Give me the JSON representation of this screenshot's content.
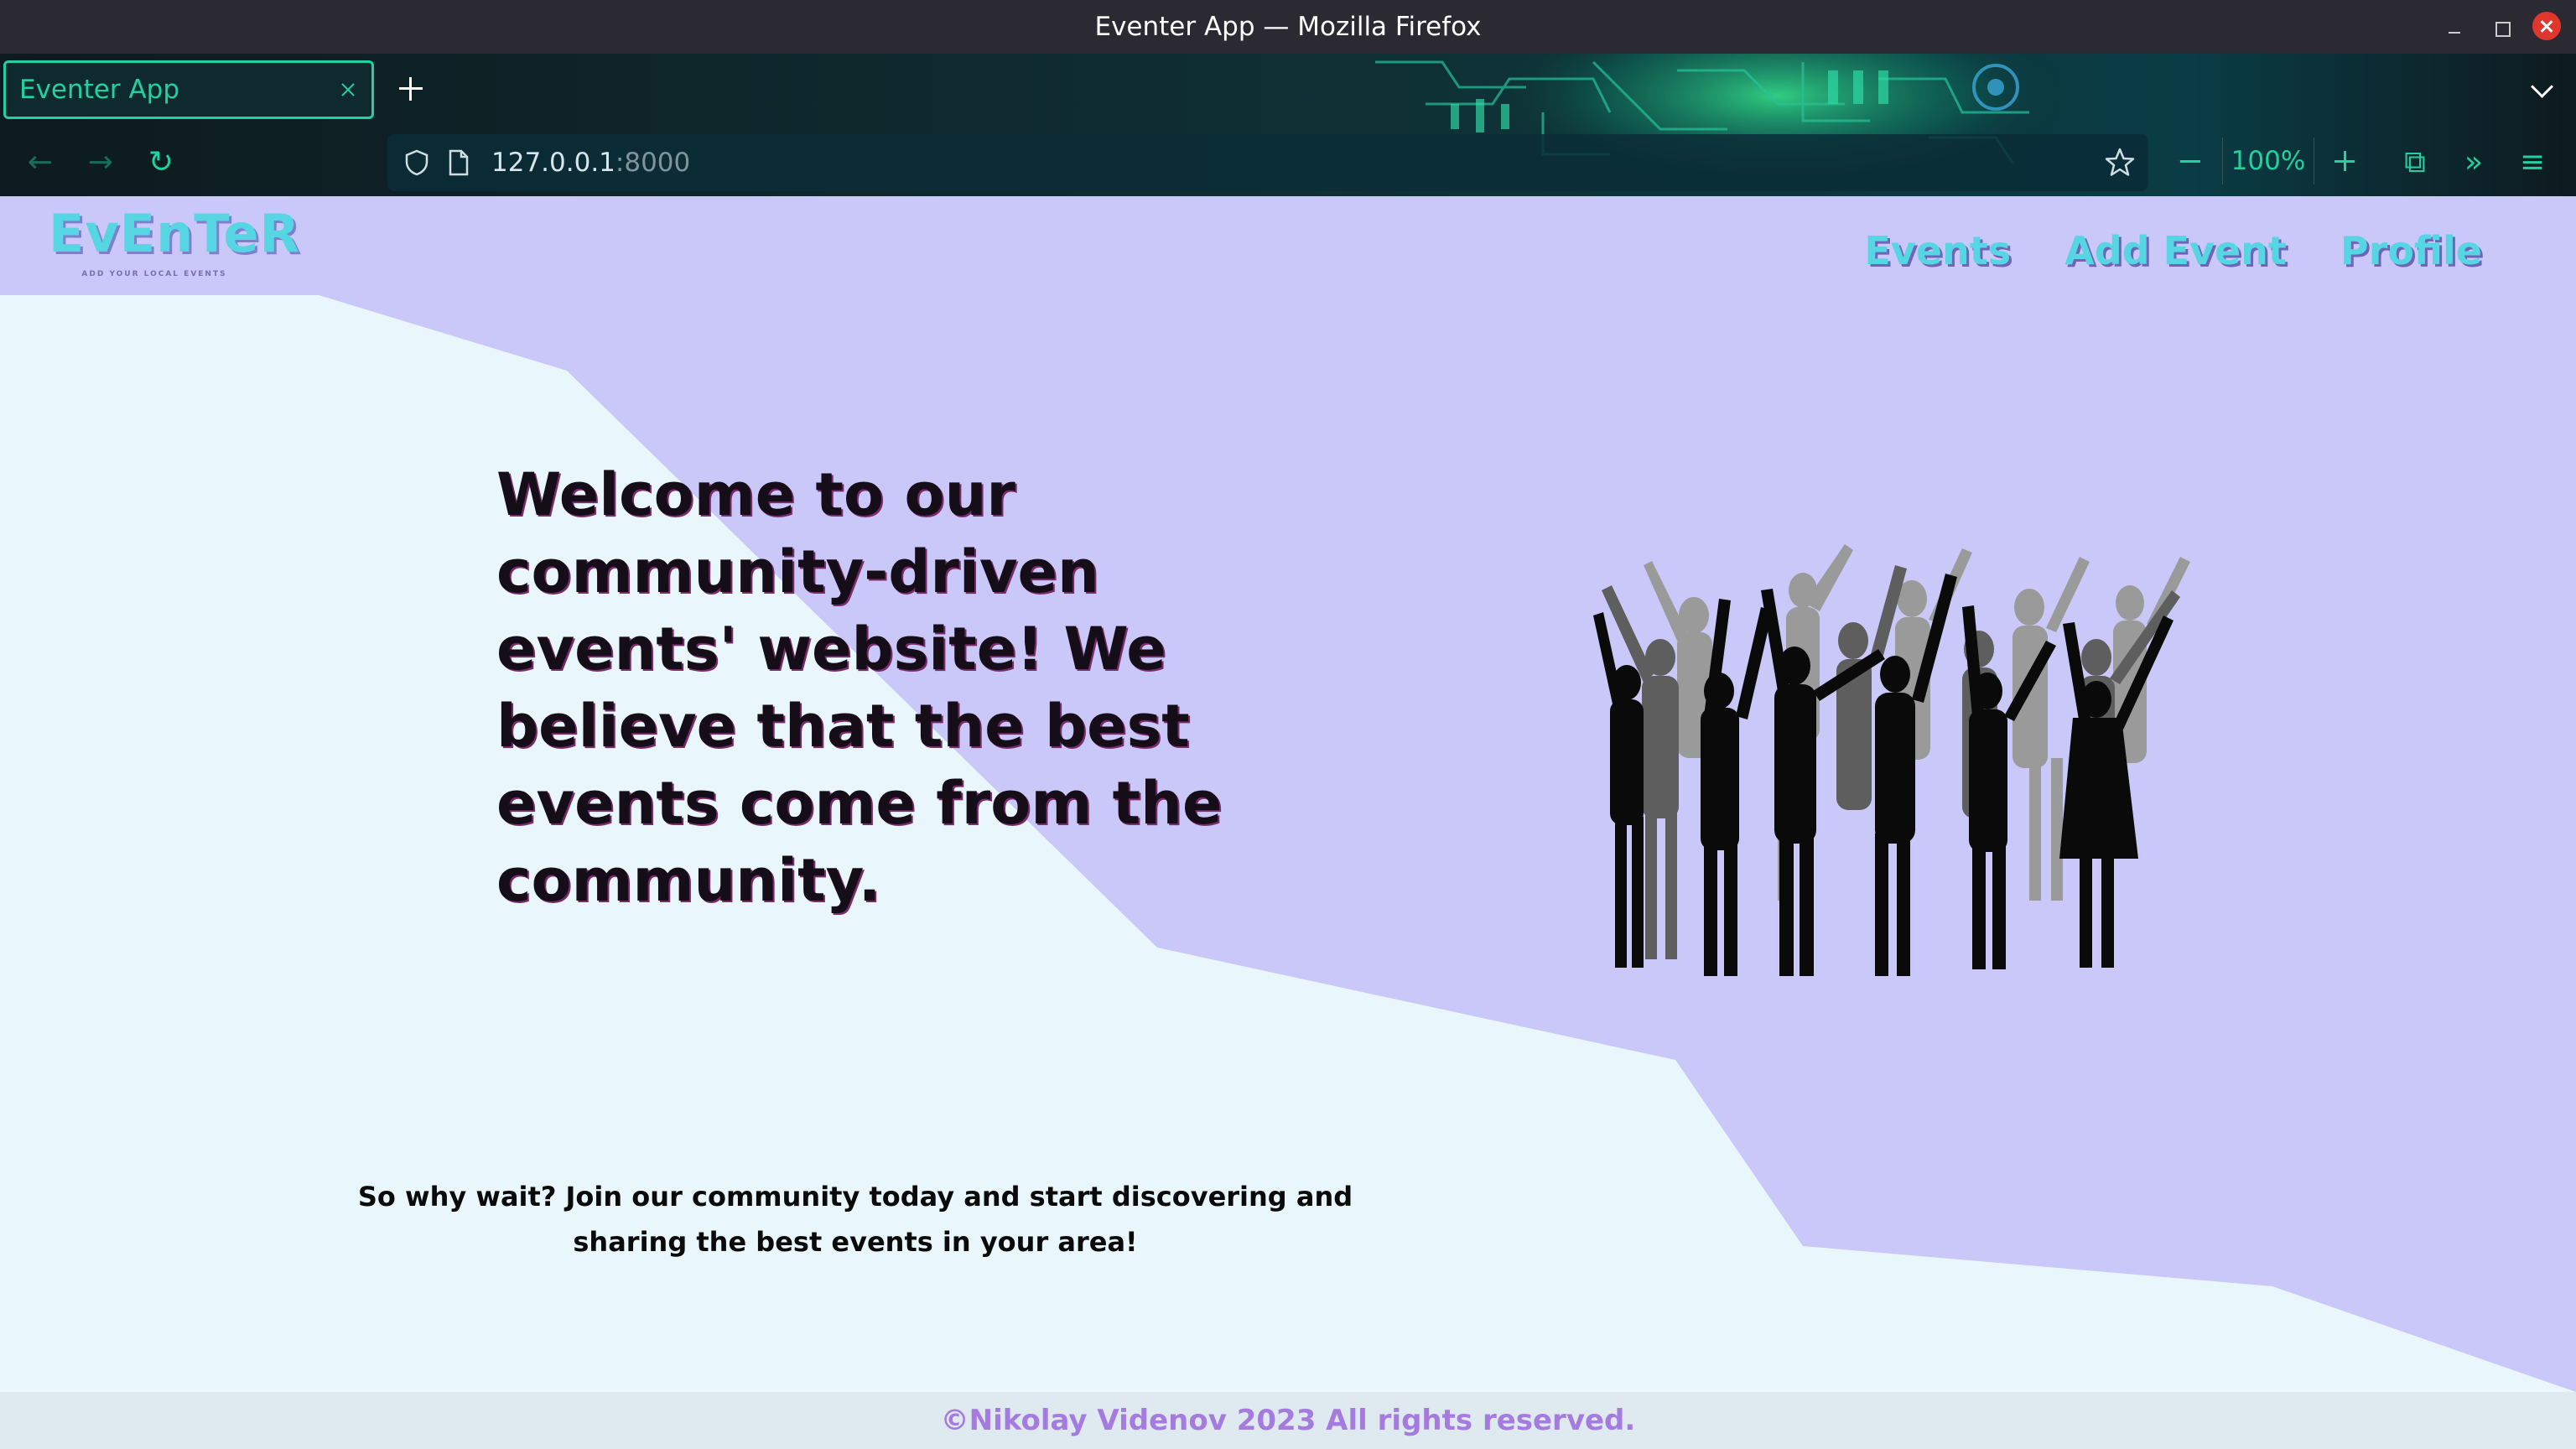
{
  "window": {
    "title": "Eventer App — Mozilla Firefox"
  },
  "browser": {
    "tab_title": "Eventer App",
    "url_host": "127.0.0.1",
    "url_port": ":8000",
    "zoom": "100%",
    "accent_color": "#21d19f"
  },
  "site": {
    "logo": "EvEnTeR",
    "tagline": "ADD YOUR LOCAL EVENTS",
    "nav": [
      "Events",
      "Add Event",
      "Profile"
    ],
    "hero_title": "Welcome to our community-driven events' website! We believe that the best events come from the community.",
    "hero_subtitle": "So why wait? Join our community today and start discovering and sharing the best events in your area!",
    "footer": "©Nikolay Videnov 2023 All rights reserved.",
    "colors": {
      "background": "#e9f7fd",
      "accent_shape": "#cac8f8",
      "nav_link": "#56d6e2",
      "footer_text": "#a57be0"
    },
    "illustration": "crowd-silhouette"
  }
}
